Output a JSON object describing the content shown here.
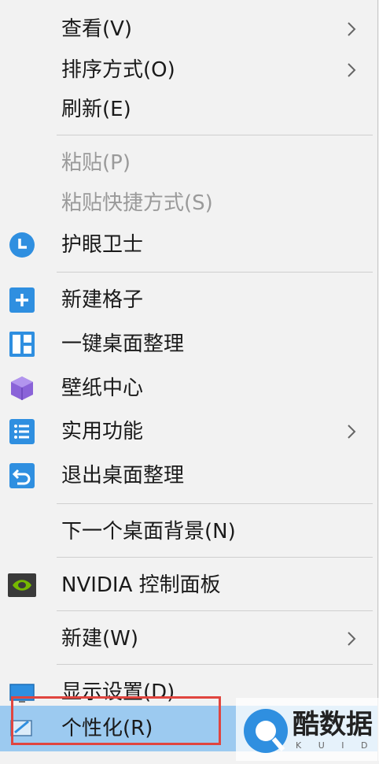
{
  "menu": {
    "items": [
      {
        "id": "view",
        "label": "查看(V)",
        "submenu": true
      },
      {
        "id": "sort",
        "label": "排序方式(O)",
        "submenu": true
      },
      {
        "id": "refresh",
        "label": "刷新(E)"
      },
      {
        "id": "paste",
        "label": "粘贴(P)",
        "disabled": true
      },
      {
        "id": "paste_shortcut",
        "label": "粘贴快捷方式(S)",
        "disabled": true
      },
      {
        "id": "eye_guard",
        "label": "护眼卫士",
        "icon": "clock-icon"
      },
      {
        "id": "new_grid",
        "label": "新建格子",
        "icon": "plus-icon"
      },
      {
        "id": "organize_desktop",
        "label": "一键桌面整理",
        "icon": "layout-grid-icon"
      },
      {
        "id": "wallpaper_center",
        "label": "壁纸中心",
        "icon": "cube-icon"
      },
      {
        "id": "utilities",
        "label": "实用功能",
        "icon": "list-icon",
        "submenu": true
      },
      {
        "id": "exit_organize",
        "label": "退出桌面整理",
        "icon": "undo-arrow-icon"
      },
      {
        "id": "next_background",
        "label": "下一个桌面背景(N)"
      },
      {
        "id": "nvidia",
        "label": "NVIDIA 控制面板",
        "icon": "nvidia-icon"
      },
      {
        "id": "new",
        "label": "新建(W)",
        "submenu": true
      },
      {
        "id": "display_settings",
        "label": "显示设置(D)",
        "icon": "monitor-icon"
      },
      {
        "id": "personalize",
        "label": "个性化(R)",
        "icon": "personalize-icon",
        "highlighted": true
      }
    ]
  },
  "watermark": {
    "text": "酷数据",
    "subtext": "K U I D"
  },
  "colors": {
    "highlight": "#9ccaf0",
    "icon_blue": "#2f8fe0",
    "icon_purple": "#8a63d8",
    "red_box": "#e0453f",
    "disabled_text": "#9a9a9a"
  }
}
